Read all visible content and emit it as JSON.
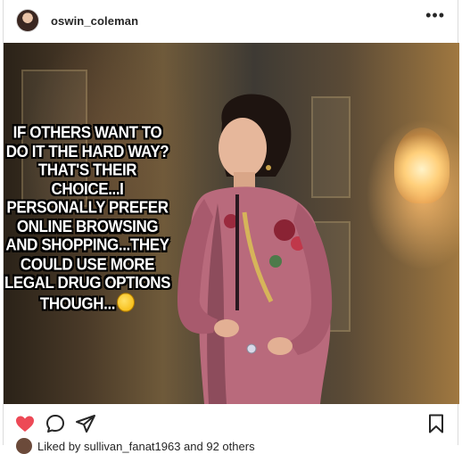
{
  "post": {
    "username": "oswin_coleman",
    "more_label": "•••",
    "overlay_text": "IF OTHERS WANT TO DO IT THE HARD WAY? THAT'S THEIR CHOICE...I PERSONALLY PREFER ONLINE BROWSING AND SHOPPING...THEY COULD USE MORE LEGAL DRUG OPTIONS THOUGH...",
    "overlay_emoji": "rolling-on-the-floor-laughing-emoji",
    "likes_text": "Liked by sullivan_fanat1963 and 92 others"
  },
  "icons": {
    "like": "heart-icon",
    "comment": "comment-icon",
    "share": "paper-plane-icon",
    "save": "bookmark-icon"
  },
  "colors": {
    "heart": "#ed4956",
    "text": "#262626",
    "border": "#dbdbdb"
  }
}
